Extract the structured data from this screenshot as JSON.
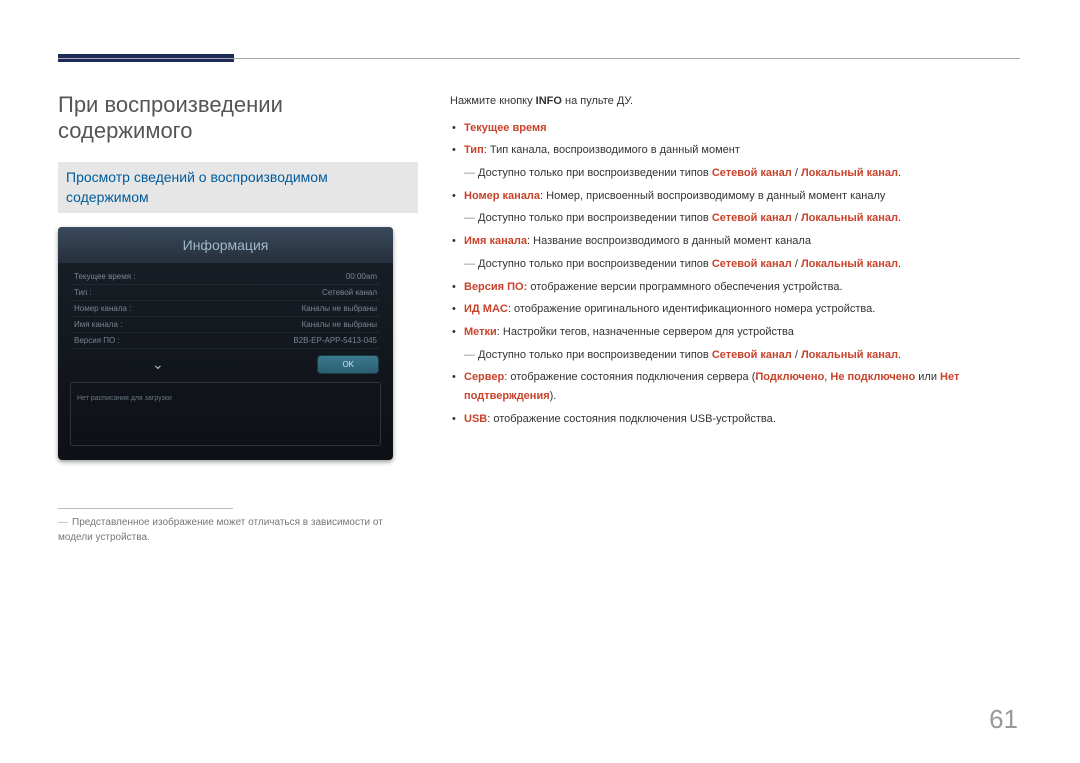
{
  "page_title": "При воспроизведении содержимого",
  "subtitle": "Просмотр сведений о воспроизводимом содержимом",
  "mockup": {
    "title": "Информация",
    "rows": [
      {
        "label": "Текущее время :",
        "value": "00:00am"
      },
      {
        "label": "Тип :",
        "value": "Сетевой канал"
      },
      {
        "label": "Номер канала :",
        "value": "Каналы не выбраны"
      },
      {
        "label": "Имя канала :",
        "value": "Каналы не выбраны"
      },
      {
        "label": "Версия ПО :",
        "value": "B2B-EP-APP-5413-045"
      }
    ],
    "ok": "OK",
    "footer": "Нет расписания для загрузки"
  },
  "footnote": "Представленное изображение может отличаться в зависимости от модели устройства.",
  "intro_prefix": "Нажмите кнопку ",
  "intro_bold": "INFO",
  "intro_suffix": " на пульте ДУ.",
  "items": {
    "current_time": "Текущее время",
    "type_label": "Тип",
    "type_text": ": Тип канала, воспроизводимого в данный момент",
    "sub_avail": "Доступно только при воспроизведении типов ",
    "net_channel": "Сетевой канал",
    "slash": " / ",
    "local_channel": "Локальный канал",
    "period": ".",
    "chnum_label": "Номер канала",
    "chnum_text": ": Номер, присвоенный воспроизводимому в данный момент каналу",
    "chname_label": "Имя канала",
    "chname_text": ": Название воспроизводимого в данный момент канала",
    "version_label": "Версия ПО:",
    "version_text": " отображение версии программного обеспечения устройства.",
    "mac_label": "ИД MAC",
    "mac_text": ": отображение оригинального идентификационного номера устройства.",
    "tags_label": "Метки",
    "tags_text": ": Настройки тегов, назначенные сервером для устройства",
    "server_label": "Сервер",
    "server_text": ": отображение состояния подключения сервера (",
    "connected": "Подключено",
    "comma": ", ",
    "not_connected": "Не подключено",
    "or": " или ",
    "no_confirm": "Нет подтверждения",
    "close_paren": ").",
    "usb_label": "USB",
    "usb_text": ": отображение состояния подключения USB-устройства."
  },
  "page_number": "61"
}
